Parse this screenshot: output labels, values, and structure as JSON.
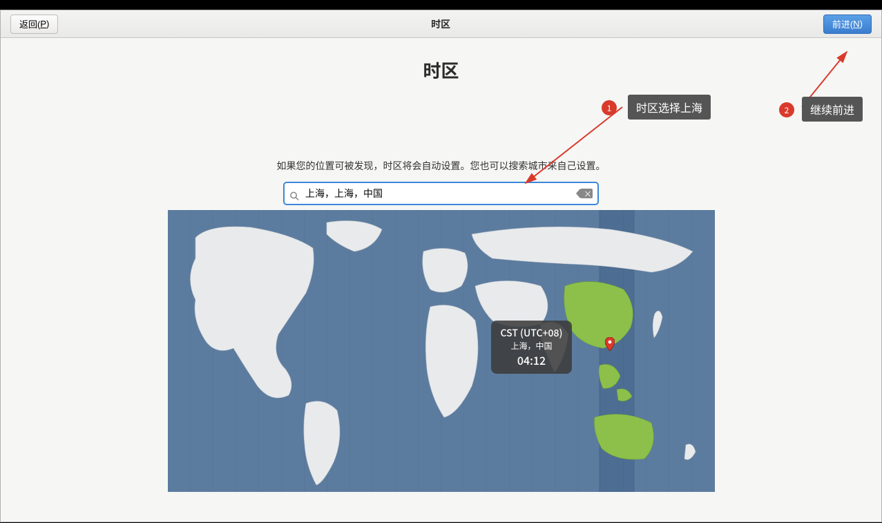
{
  "header": {
    "back_label": "返回(P)",
    "back_shortcut": "P",
    "back_prefix": "返回(",
    "back_suffix": ")",
    "title": "时区",
    "next_label": "前进(N)",
    "next_shortcut": "N",
    "next_prefix": "前进(",
    "next_suffix": ")"
  },
  "page": {
    "heading": "时区",
    "hint": "如果您的位置可被发现，时区将会自动设置。您也可以搜索城市来自己设置。"
  },
  "search": {
    "value": "上海，上海，中国",
    "placeholder": ""
  },
  "map": {
    "tooltip": {
      "tz_code": "CST (UTC+08)",
      "location": "上海，中国",
      "time": "04:12"
    }
  },
  "annotations": {
    "callout1": {
      "num": "1",
      "text": "时区选择上海"
    },
    "callout2": {
      "num": "2",
      "text": "继续前进"
    }
  }
}
